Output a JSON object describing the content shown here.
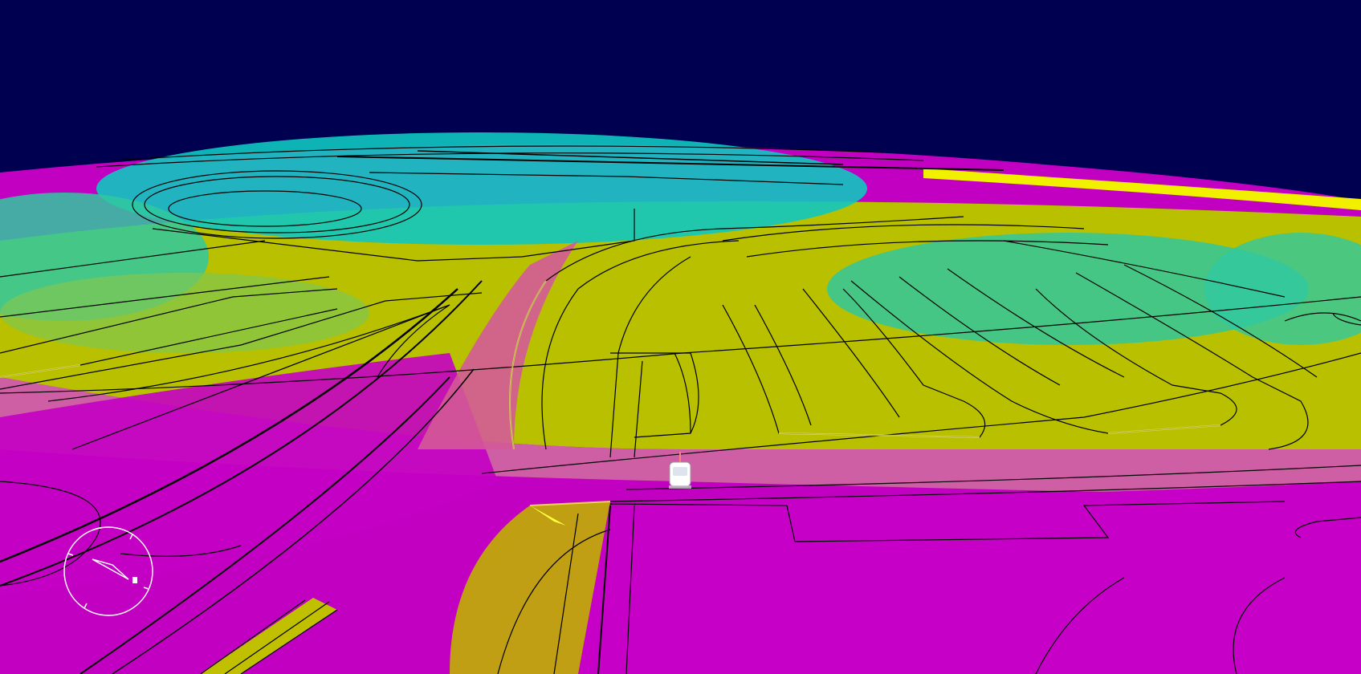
{
  "colors": {
    "sky": "#000050",
    "ground_low": "#c800c8",
    "ground_mid_low": "#d4559b",
    "ground_mid": "#c8c800",
    "ground_mid_high": "#78c850",
    "ground_high": "#00c8c8",
    "contour": "#000000",
    "vehicle": "#ffffff",
    "compass": "#ffffff"
  },
  "scene": {
    "view": "3d-perspective",
    "colormap": "elevation",
    "vehicle_icon": "car-icon",
    "compass_icon": "compass-icon"
  }
}
